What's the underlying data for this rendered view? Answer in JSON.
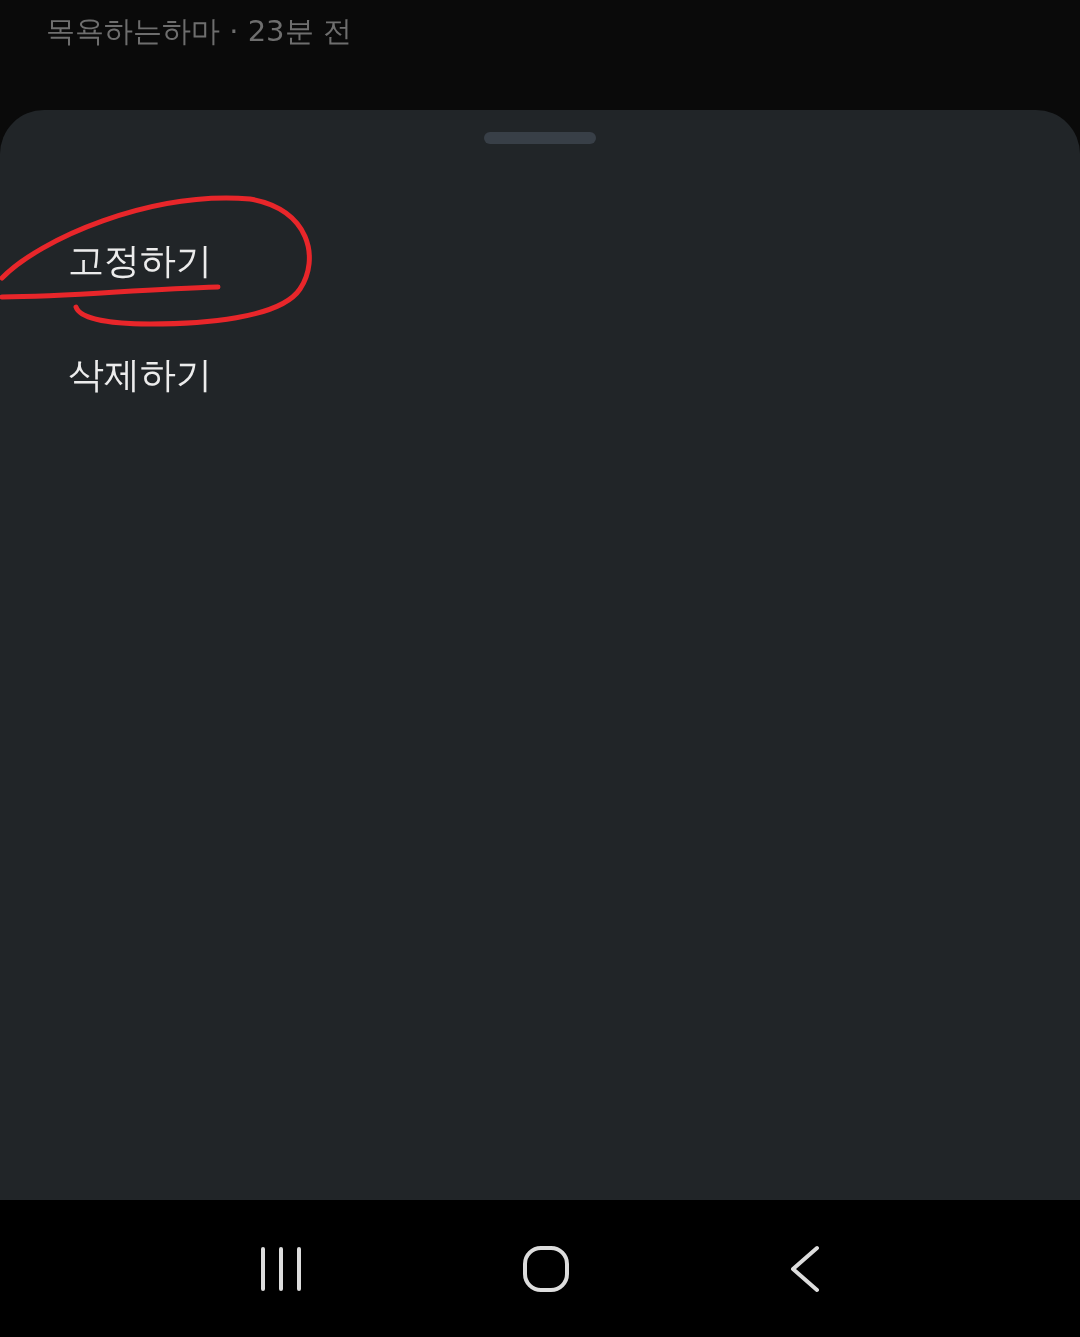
{
  "comment": {
    "author": "목욕하는하마",
    "separator": "·",
    "time": "23분 전"
  },
  "sheet": {
    "items": [
      {
        "label": "고정하기",
        "annotated": true
      },
      {
        "label": "삭제하기",
        "annotated": false
      }
    ]
  },
  "nav_bar": {
    "buttons": [
      {
        "kind": "recents"
      },
      {
        "kind": "home"
      },
      {
        "kind": "back"
      }
    ]
  }
}
